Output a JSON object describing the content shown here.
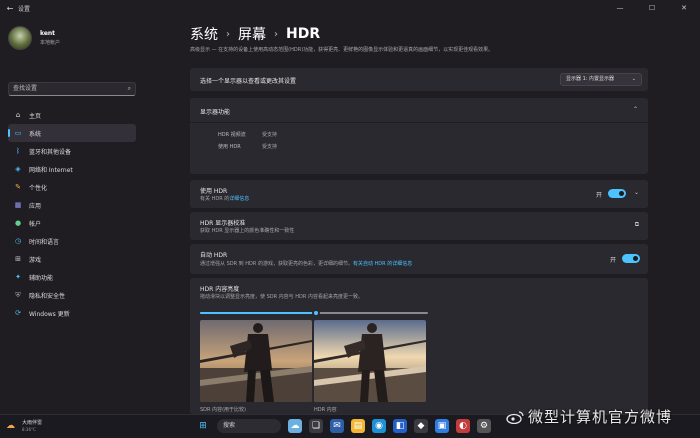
{
  "window": {
    "title": "设置",
    "back_icon": "back-arrow-icon",
    "controls": [
      "—",
      "☐",
      "✕"
    ]
  },
  "profile": {
    "name": "kent",
    "subtitle": "本地帐户"
  },
  "search": {
    "placeholder": "查找设置",
    "icon": "search-icon"
  },
  "nav": {
    "items": [
      {
        "label": "主页",
        "icon": "home-icon",
        "glyph": "⌂",
        "color": "#d9d9d9",
        "active": false
      },
      {
        "label": "系统",
        "icon": "monitor-icon",
        "glyph": "▭",
        "color": "#4cc2ff",
        "active": true
      },
      {
        "label": "蓝牙和其他设备",
        "icon": "bluetooth-icon",
        "glyph": "ᛒ",
        "color": "#4cc2ff",
        "active": false
      },
      {
        "label": "网络和 Internet",
        "icon": "wifi-icon",
        "glyph": "◈",
        "color": "#4cc2ff",
        "active": false
      },
      {
        "label": "个性化",
        "icon": "brush-icon",
        "glyph": "✎",
        "color": "#f3b24a",
        "active": false
      },
      {
        "label": "应用",
        "icon": "apps-icon",
        "glyph": "▦",
        "color": "#9a9dff",
        "active": false
      },
      {
        "label": "帐户",
        "icon": "account-icon",
        "glyph": "●",
        "color": "#5fd08e",
        "active": false
      },
      {
        "label": "时间和语言",
        "icon": "clock-globe-icon",
        "glyph": "◷",
        "color": "#4cc2ff",
        "active": false
      },
      {
        "label": "游戏",
        "icon": "gamepad-icon",
        "glyph": "⊞",
        "color": "#c7c7c7",
        "active": false
      },
      {
        "label": "辅助功能",
        "icon": "accessibility-icon",
        "glyph": "✦",
        "color": "#4cc2ff",
        "active": false
      },
      {
        "label": "隐私和安全性",
        "icon": "shield-icon",
        "glyph": "⛨",
        "color": "#9fa3b3",
        "active": false
      },
      {
        "label": "Windows 更新",
        "icon": "update-icon",
        "glyph": "⟳",
        "color": "#4cc2ff",
        "active": false
      }
    ]
  },
  "breadcrumb": {
    "part1": "系统",
    "part2": "屏幕",
    "current": "HDR",
    "sep": "›"
  },
  "description": "高级显示 — 在支持的设备上使用高动态范围(HDR)功能，获得更亮、更鲜艳的图像显示体验和更逼真的画面细节，以实现更佳观看效果。",
  "display_select": {
    "label": "选择一个显示器以查看或更改其设置",
    "value": "显示器 1: 内置显示器"
  },
  "capabilities": {
    "title": "显示器功能",
    "rows": [
      {
        "label": "HDR 视频流",
        "value": "受支持"
      },
      {
        "label": "使用 HDR",
        "value": "受支持"
      }
    ]
  },
  "use_hdr": {
    "title": "使用 HDR",
    "sub_prefix": "有关 HDR 的",
    "sub_link": "详细信息",
    "state": "开"
  },
  "calibration": {
    "title": "HDR 显示器校准",
    "sub": "获取 HDR 显示器上的颜色准确性和一致性"
  },
  "auto_hdr": {
    "title": "自动 HDR",
    "sub_prefix": "通过增强从 SDR 到 HDR 的游戏，获取更亮的色彩，更详细的细节。",
    "sub_link": "有关自动 HDR 的详细信息",
    "state": "开"
  },
  "brightness": {
    "title": "HDR 内容亮度",
    "sub": "拖动滑块以调整显示亮度，使 SDR 内容与 HDR 内容看起来亮度更一致。",
    "level_percent": 51,
    "caption_sdr": "SDR 内容(用于比较)",
    "caption_hdr": "HDR 内容"
  },
  "taskbar": {
    "weather_temp": "大雨伴雷",
    "weather_sub": "8:36°C",
    "search": "搜索",
    "start_icon": "windows-start-icon"
  },
  "watermark": {
    "text": "微型计算机官方微博",
    "icon": "weibo-logo-icon"
  }
}
